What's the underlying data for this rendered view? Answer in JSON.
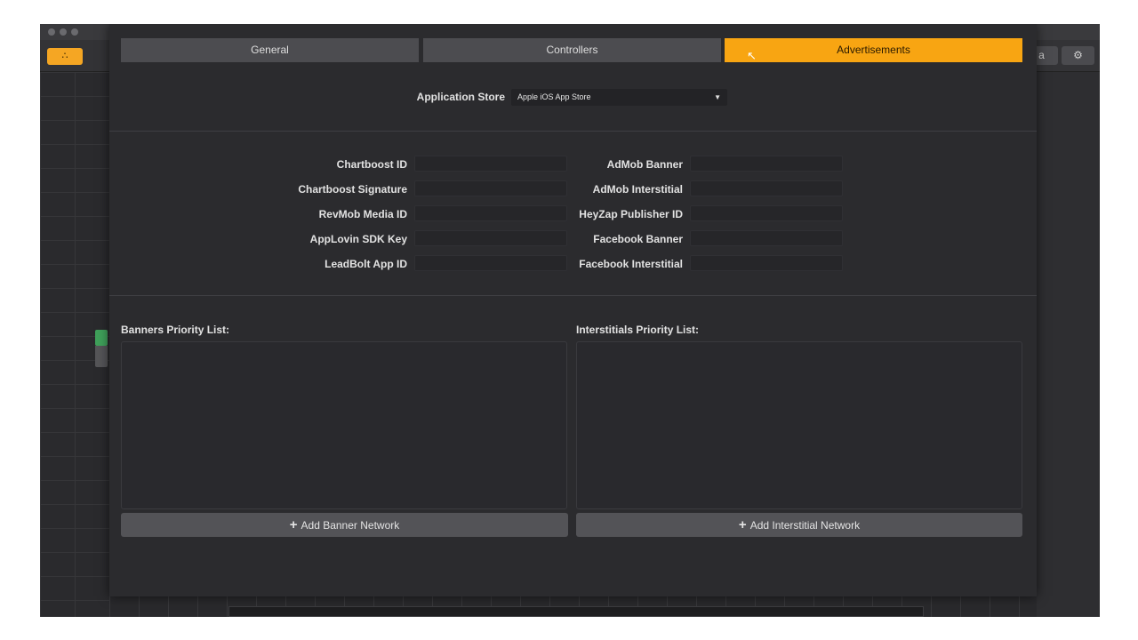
{
  "window": {
    "toolbar": {
      "home_icon_glyph": "∴",
      "right_button_1": "a",
      "right_button_2_icon": "⚙"
    }
  },
  "tabs": [
    {
      "label": "General",
      "active": false
    },
    {
      "label": "Controllers",
      "active": false
    },
    {
      "label": "Advertisements",
      "active": true
    }
  ],
  "store": {
    "label": "Application Store",
    "selected": "Apple iOS App Store"
  },
  "left_fields": [
    {
      "label": "Chartboost ID",
      "value": ""
    },
    {
      "label": "Chartboost Signature",
      "value": ""
    },
    {
      "label": "RevMob Media ID",
      "value": ""
    },
    {
      "label": "AppLovin SDK Key",
      "value": ""
    },
    {
      "label": "LeadBolt App ID",
      "value": ""
    }
  ],
  "right_fields": [
    {
      "label": "AdMob Banner",
      "value": ""
    },
    {
      "label": "AdMob Interstitial",
      "value": ""
    },
    {
      "label": "HeyZap Publisher ID",
      "value": ""
    },
    {
      "label": "Facebook Banner",
      "value": ""
    },
    {
      "label": "Facebook Interstitial",
      "value": ""
    }
  ],
  "banners": {
    "title": "Banners Priority List:",
    "add_label": "Add Banner Network",
    "plus": "+"
  },
  "interstitials": {
    "title": "Interstitials Priority List:",
    "add_label": "Add Interstitial Network",
    "plus": "+"
  },
  "colors": {
    "accent": "#f8a512",
    "dialog_bg": "#2b2b2e"
  }
}
